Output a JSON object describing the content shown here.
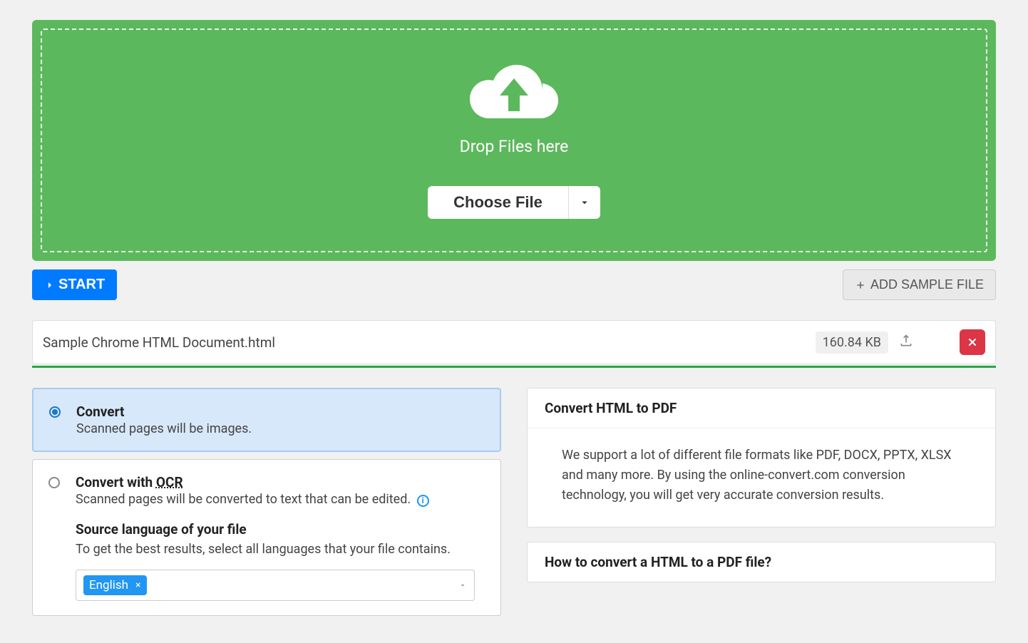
{
  "dropzone": {
    "label": "Drop Files here",
    "choose_file": "Choose File"
  },
  "actions": {
    "start": "START",
    "add_sample": "ADD SAMPLE FILE"
  },
  "file": {
    "name": "Sample Chrome HTML Document.html",
    "size": "160.84 KB"
  },
  "options": {
    "convert": {
      "title": "Convert",
      "desc": "Scanned pages will be images."
    },
    "ocr": {
      "title_pre": "Convert with ",
      "title_ocr": "OCR",
      "desc": "Scanned pages will be converted to text that can be edited.",
      "lang_title": "Source language of your file",
      "lang_desc": "To get the best results, select all languages that your file contains.",
      "selected_language": "English"
    }
  },
  "panels": {
    "convert_info": {
      "title": "Convert HTML to PDF",
      "body": "We support a lot of different file formats like PDF, DOCX, PPTX, XLSX and many more. By using the online-convert.com conversion technology, you will get very accurate conversion results."
    },
    "howto": {
      "title": "How to convert a HTML to a PDF file?"
    }
  }
}
